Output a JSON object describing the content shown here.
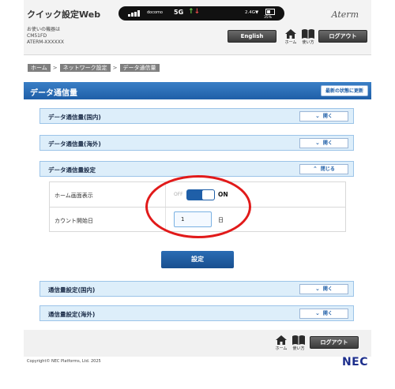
{
  "header": {
    "app_title": "クイック設定Web",
    "device_label": "お使いの機器は",
    "device_model": "CM51FD",
    "device_id": "ATERM-XXXXXX",
    "brand": "Aterm",
    "status": {
      "carrier": "docomo",
      "network": "5G",
      "speed": "2.4G▼",
      "battery_pct": "35%"
    },
    "english_button": "English",
    "home_label": "ホーム",
    "howto_label": "使い方",
    "logout_button": "ログアウト"
  },
  "breadcrumb": {
    "items": [
      "ホーム",
      "ネットワーク設定",
      "データ通信量"
    ],
    "separator": ">"
  },
  "section": {
    "title": "データ通信量",
    "refresh_button": "最新の状態に更新"
  },
  "accordions": [
    {
      "label": "データ通信量(国内)",
      "toggle": "開く",
      "expanded": false
    },
    {
      "label": "データ通信量(海外)",
      "toggle": "開く",
      "expanded": false
    },
    {
      "label": "データ通信量設定",
      "toggle": "閉じる",
      "expanded": true
    },
    {
      "label": "通信量設定(国内)",
      "toggle": "開く",
      "expanded": false
    },
    {
      "label": "通信量設定(海外)",
      "toggle": "開く",
      "expanded": false
    }
  ],
  "settings": {
    "home_display_label": "ホーム画面表示",
    "switch_off": "OFF",
    "switch_on": "ON",
    "switch_state": "on",
    "count_start_label": "カウント開始日",
    "count_start_value": "1",
    "count_start_unit": "日"
  },
  "submit_button": "設定",
  "footer": {
    "home_label": "ホーム",
    "howto_label": "使い方",
    "logout_button": "ログアウト",
    "copyright": "Copyright© NEC Platforms, Ltd. 2025",
    "logo": "NEC"
  },
  "colors": {
    "accent_blue": "#1f5fa8",
    "accordion_bg": "#ddeefa",
    "highlight_red": "#e11a1a",
    "nec_blue": "#1d2f8c"
  }
}
